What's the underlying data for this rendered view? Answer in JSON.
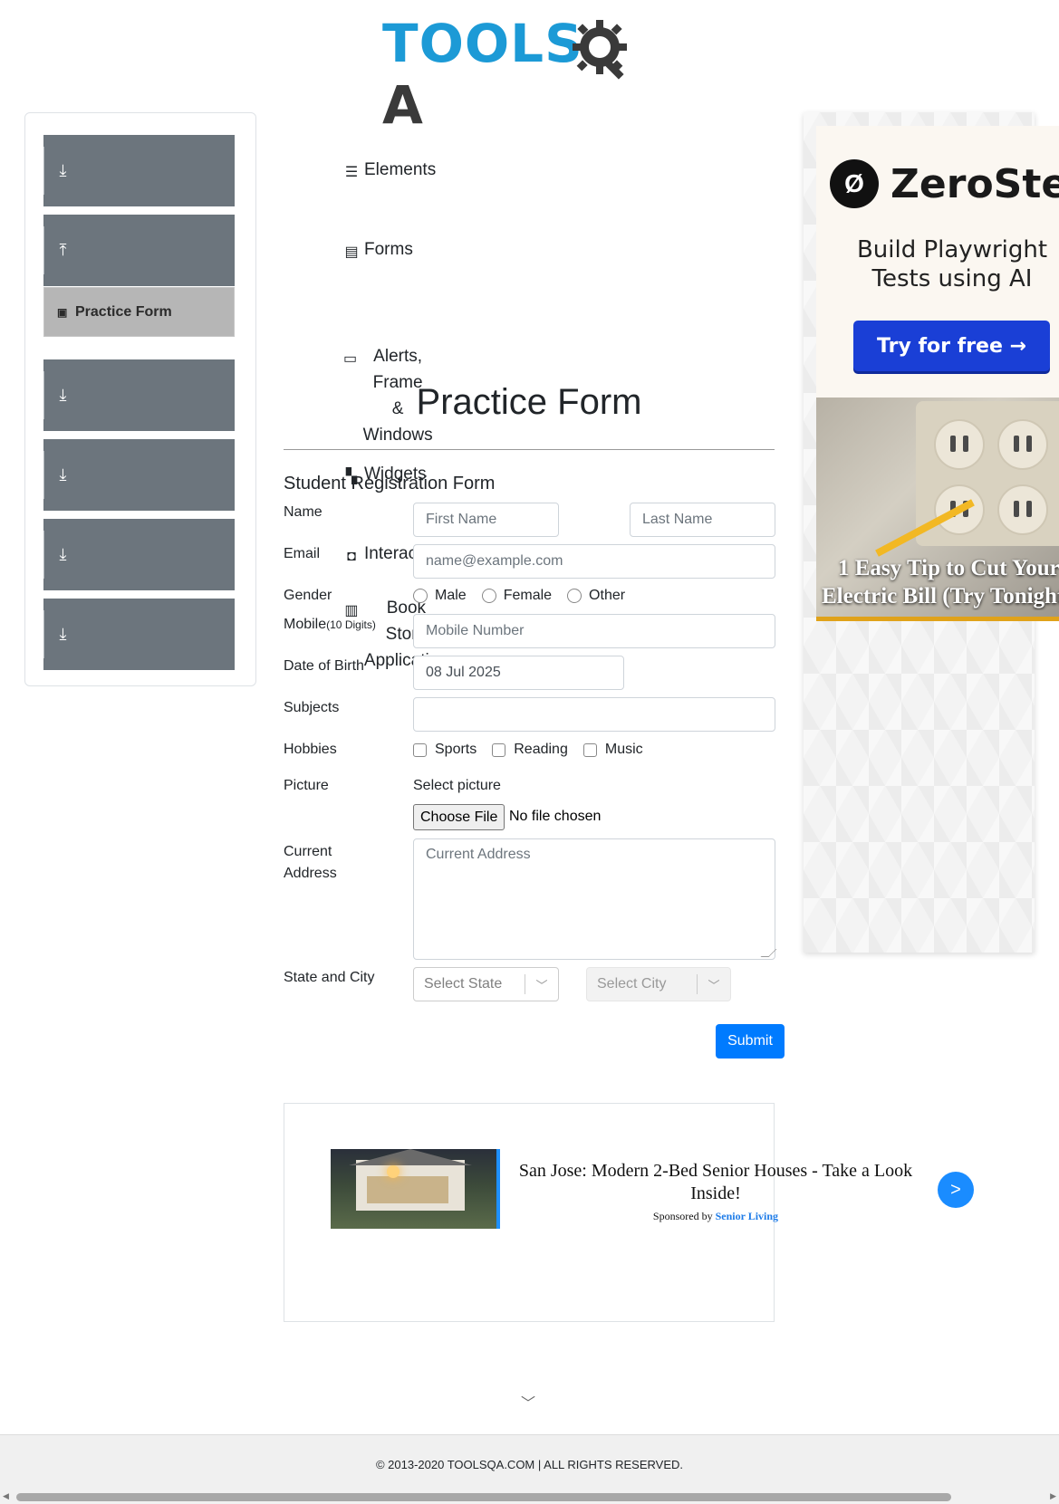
{
  "logo": {
    "text_a": "TOOLS",
    "text_b": "QA"
  },
  "sidebar": {
    "groups": [
      {
        "label": "Elements",
        "icon": "hamburger-icon"
      },
      {
        "label": "Forms",
        "icon": "document-icon"
      },
      {
        "label": "Alerts, Frame & Windows",
        "line1": "Alerts, Frame",
        "line2": "& Windows",
        "icon": "window-icon"
      },
      {
        "label": "Widgets",
        "icon": "widgets-icon"
      },
      {
        "label": "Interactions",
        "icon": "interactions-icon"
      },
      {
        "label": "Book Store Application",
        "line1": "Book Store",
        "line2": "Application",
        "icon": "books-icon"
      }
    ],
    "active_item": "Practice Form"
  },
  "form": {
    "page_title": "Practice Form",
    "section_title": "Student Registration Form",
    "name_label": "Name",
    "first_name_placeholder": "First Name",
    "last_name_placeholder": "Last Name",
    "email_label": "Email",
    "email_placeholder": "name@example.com",
    "gender_label": "Gender",
    "gender_options": [
      "Male",
      "Female",
      "Other"
    ],
    "mobile_label": "Mobile",
    "mobile_hint": "(10 Digits)",
    "mobile_placeholder": "Mobile Number",
    "dob_label": "Date of Birth",
    "dob_value": "08 Jul 2025",
    "subjects_label": "Subjects",
    "hobbies_label": "Hobbies",
    "hobbies_options": [
      "Sports",
      "Reading",
      "Music"
    ],
    "picture_label": "Picture",
    "picture_select": "Select picture",
    "choose_file": "Choose File",
    "no_file": "No file chosen",
    "address_label_1": "Current",
    "address_label_2": "Address",
    "address_placeholder": "Current Address",
    "state_city_label": "State and City",
    "state_placeholder": "Select State",
    "city_placeholder": "Select City",
    "submit_label": "Submit"
  },
  "right_ad": {
    "brand": "ZeroStep",
    "tagline_1": "Build Playwright",
    "tagline_2": "Tests using AI",
    "cta": "Try for free →",
    "tip_line_1": "1 Easy Tip to Cut Your",
    "tip_line_2": "Electric Bill (Try Tonight"
  },
  "bottom_ad": {
    "headline": "San Jose: Modern 2-Bed Senior Houses - Take a Look Inside!",
    "sponsored_by": "Sponsored by",
    "sponsor": "Senior Living",
    "next": ">"
  },
  "footer": {
    "copyright": "© 2013-2020 TOOLSQA.COM | ALL RIGHTS RESERVED."
  }
}
